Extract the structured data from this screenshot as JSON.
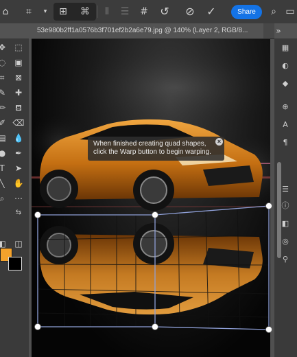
{
  "options_bar": {
    "share_label": "Share"
  },
  "document_tab": {
    "title": "53e980b2ff1a0576b3f701ef2b2a6e79.jpg @ 140% (Layer 2, RGB/8..."
  },
  "tooltip": {
    "line1": "When finished creating quad shapes,",
    "line2": "click the Warp button to begin warping."
  },
  "colors": {
    "foreground": "#f4a22c",
    "background": "#000000",
    "accent": "#1473e6"
  }
}
